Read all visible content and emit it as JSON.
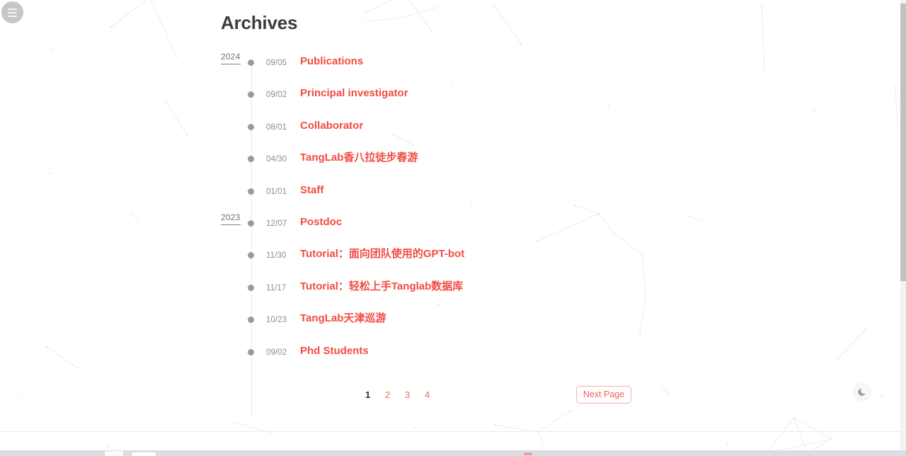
{
  "menu": {
    "icon": "hamburger-menu-icon",
    "label": ""
  },
  "header": {
    "title": "Archives"
  },
  "archives": {
    "entries": [
      {
        "year": "2024",
        "date": "09/05",
        "title": "Publications"
      },
      {
        "year": "",
        "date": "09/02",
        "title": "Principal investigator"
      },
      {
        "year": "",
        "date": "08/01",
        "title": "Collaborator"
      },
      {
        "year": "",
        "date": "04/30",
        "title": "TangLab香八拉徒步春游"
      },
      {
        "year": "",
        "date": "01/01",
        "title": "Staff"
      },
      {
        "year": "2023",
        "date": "12/07",
        "title": "Postdoc"
      },
      {
        "year": "",
        "date": "11/30",
        "title": "Tutorial：面向团队使用的GPT-bot"
      },
      {
        "year": "",
        "date": "11/17",
        "title": "Tutorial：轻松上手Tanglab数据库"
      },
      {
        "year": "",
        "date": "10/23",
        "title": "TangLab天津巡游"
      },
      {
        "year": "",
        "date": "09/02",
        "title": "Phd Students"
      }
    ]
  },
  "pagination": {
    "pages": [
      {
        "label": "1",
        "current": true
      },
      {
        "label": "2",
        "current": false
      },
      {
        "label": "3",
        "current": false
      },
      {
        "label": "4",
        "current": false
      }
    ],
    "next_label": "Next Page"
  },
  "theme_toggle": {
    "icon": "moon-icon"
  },
  "colors": {
    "accent_red": "#f14c42",
    "link_red": "#f2645a",
    "title_dark": "#3c3c3c",
    "date_gray": "#8c8c8c",
    "dot_gray": "#9a9a9a",
    "menu_gray": "#c6c6c6"
  }
}
